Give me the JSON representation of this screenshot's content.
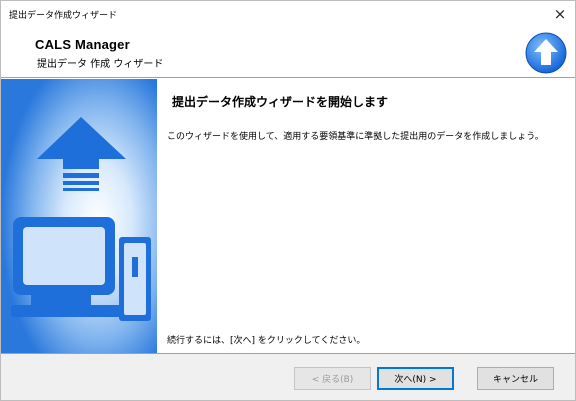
{
  "window": {
    "title": "提出データ作成ウィザード",
    "close_glyph": "×"
  },
  "header": {
    "app_name": "CALS Manager",
    "subtitle": "提出データ 作成 ウィザード",
    "logo_icon": "upload-arrow-circle-icon"
  },
  "side_image": {
    "icon": "computer-upload-illustration",
    "colors": {
      "deep_blue": "#1e6fd9",
      "light_blue": "#cfe3fb"
    }
  },
  "content": {
    "heading": "提出データ作成ウィザードを開始します",
    "description": "このウィザードを使用して、適用する要領基準に準拠した提出用のデータを作成しましょう。",
    "footer_note": "続行するには、[次へ] をクリックしてください。"
  },
  "buttons": {
    "back_label": "< 戻る(B)",
    "next_label": "次へ(N) >",
    "cancel_label": "キャンセル"
  }
}
